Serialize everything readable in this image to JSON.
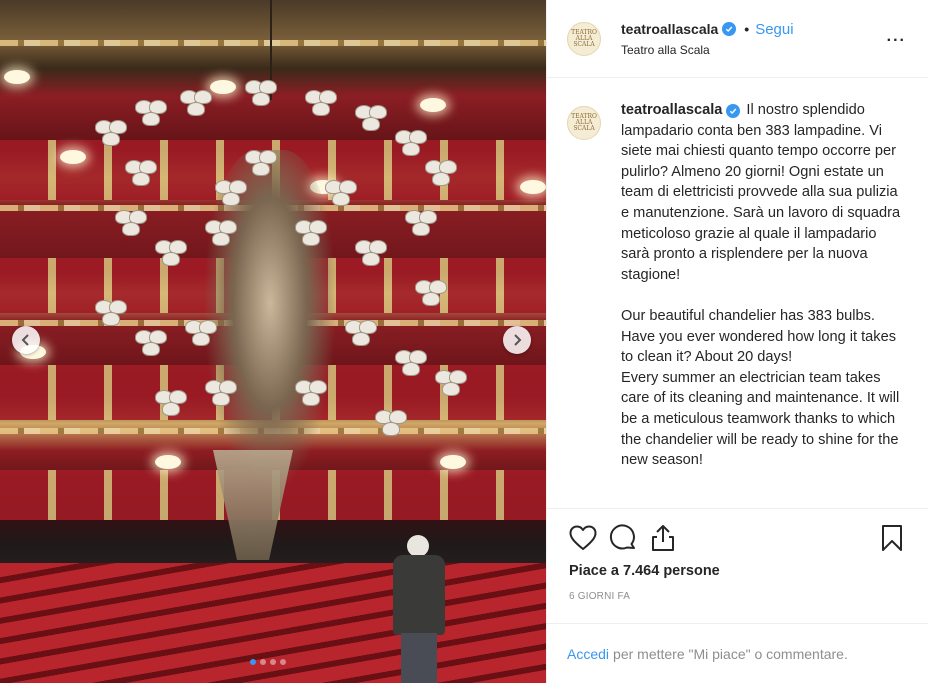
{
  "post": {
    "username": "teatroallascala",
    "follow_label": "Segui",
    "separator": "•",
    "location": "Teatro alla Scala",
    "more_label": "...",
    "avatar_text": "TEATRO ALLA SCALA",
    "caption_text": "Il nostro splendido lampadario conta ben 383 lampadine. Vi siete mai chiesti quanto tempo occorre per pulirlo? Almeno 20 giorni! Ogni estate un team di elettricisti provvede alla sua pulizia e manutenzione. Sarà un lavoro di squadra meticoloso grazie al quale il lampadario sarà pronto a risplendere per la nuova stagione!\n\nOur beautiful chandelier has 383 bulbs. Have you ever wondered how long it takes to clean it? About 20 days!\nEvery summer an electrician team takes care of its cleaning and maintenance. It will be a meticulous teamwork thanks to which the chandelier will be ready to shine for the new season!",
    "likes": "Piace a 7.464 persone",
    "time": "6 giorni fa"
  },
  "comment_bar": {
    "login": "Accedi",
    "rest": "per mettere \"Mi piace\" o commentare."
  },
  "carousel": {
    "total": 4,
    "active_index": 0
  },
  "icons": {
    "like": "heart-icon",
    "comment": "comment-icon",
    "share": "share-icon",
    "save": "bookmark-icon",
    "verified": "verified-badge-icon",
    "prev": "chevron-left-icon",
    "next": "chevron-right-icon"
  },
  "colors": {
    "accent": "#3897f0",
    "text": "#262626",
    "muted": "#8e8e8e"
  }
}
